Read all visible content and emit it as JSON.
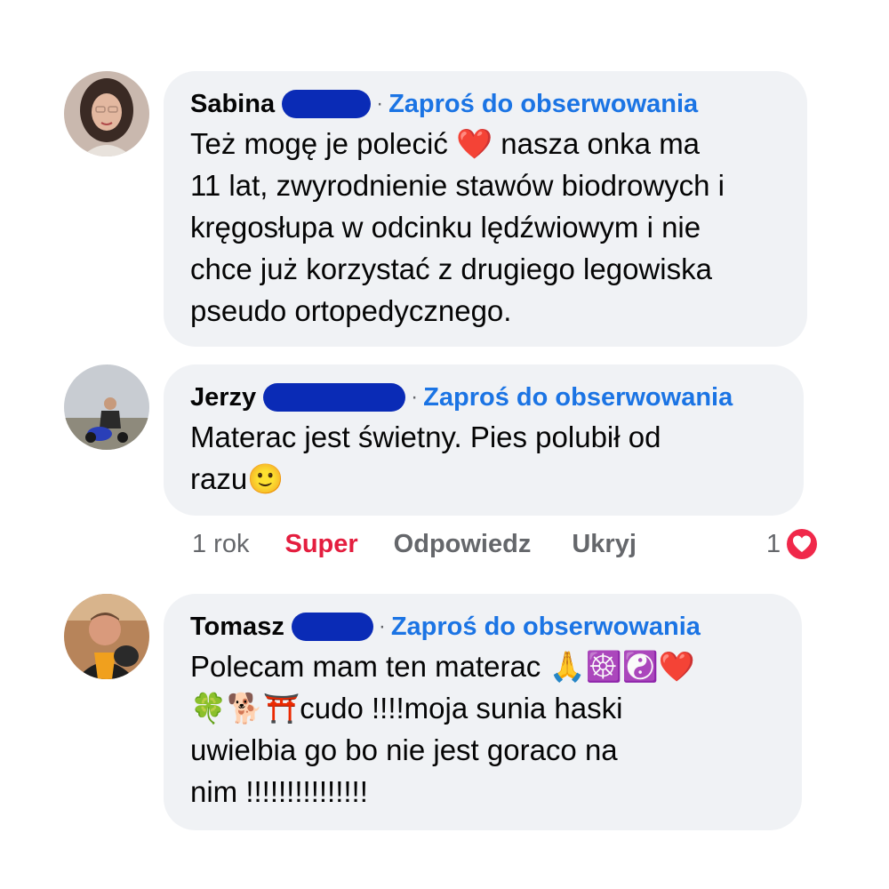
{
  "comments": [
    {
      "author": "Sabina",
      "separator": "·",
      "follow_link": "Zaproś do obserwowania",
      "text_lines": [
        "Też mogę je polecić ❤️ nasza onka ma",
        "11 lat, zwyrodnienie stawów biodrowych i",
        "kręgosłupa w odcinku lędźwiowym i nie",
        "chce już korzystać z drugiego legowiska",
        "pseudo ortopedycznego."
      ]
    },
    {
      "author": "Jerzy",
      "separator": "·",
      "follow_link": "Zaproś do obserwowania",
      "text_lines": [
        "Materac jest świetny. Pies polubił od",
        "razu🙂"
      ],
      "actions": {
        "time": "1 rok",
        "reaction_label": "Super",
        "reply_label": "Odpowiedz",
        "hide_label": "Ukryj",
        "reaction_count": "1"
      }
    },
    {
      "author": "Tomasz",
      "separator": "·",
      "follow_link": "Zaproś do obserwowania",
      "text_lines": [
        "Polecam mam ten materac 🙏☸️☯️❤️",
        "🍀🐕⛩️cudo !!!!moja sunia haski",
        "uwielbia go bo nie jest goraco na",
        "nim !!!!!!!!!!!!!!!"
      ]
    }
  ],
  "colors": {
    "bubble": "#f0f2f5",
    "link": "#1b74e4",
    "redaction": "#0a2bb6",
    "reaction_red": "#e41e3f",
    "muted": "#65676b"
  },
  "icons": {
    "reaction": "love-heart-icon"
  }
}
